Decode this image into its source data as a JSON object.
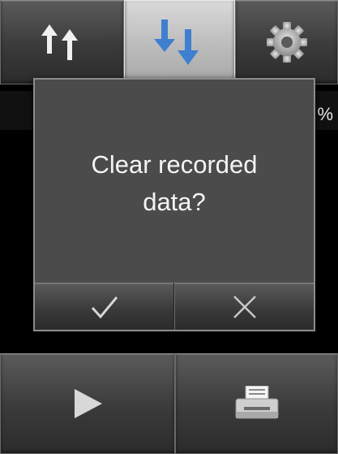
{
  "toolbar": {
    "items": [
      {
        "icon": "upload-arrows-icon",
        "selected": false
      },
      {
        "icon": "download-arrows-icon",
        "selected": true
      },
      {
        "icon": "gear-icon",
        "selected": false
      }
    ]
  },
  "readout": {
    "text": "%"
  },
  "dialog": {
    "message_line1": "Clear recorded",
    "message_line2": "data?",
    "confirm_icon": "checkmark-icon",
    "cancel_icon": "close-icon"
  },
  "bottom_bar": {
    "play_icon": "play-icon",
    "print_icon": "printer-icon"
  },
  "colors": {
    "accent_blue": "#3f7fd0",
    "button_dark": "#3a3a3a",
    "selected_tab": "#c4c4c4",
    "dialog_bg": "#4b4b4b",
    "text": "#f4f4f4"
  }
}
